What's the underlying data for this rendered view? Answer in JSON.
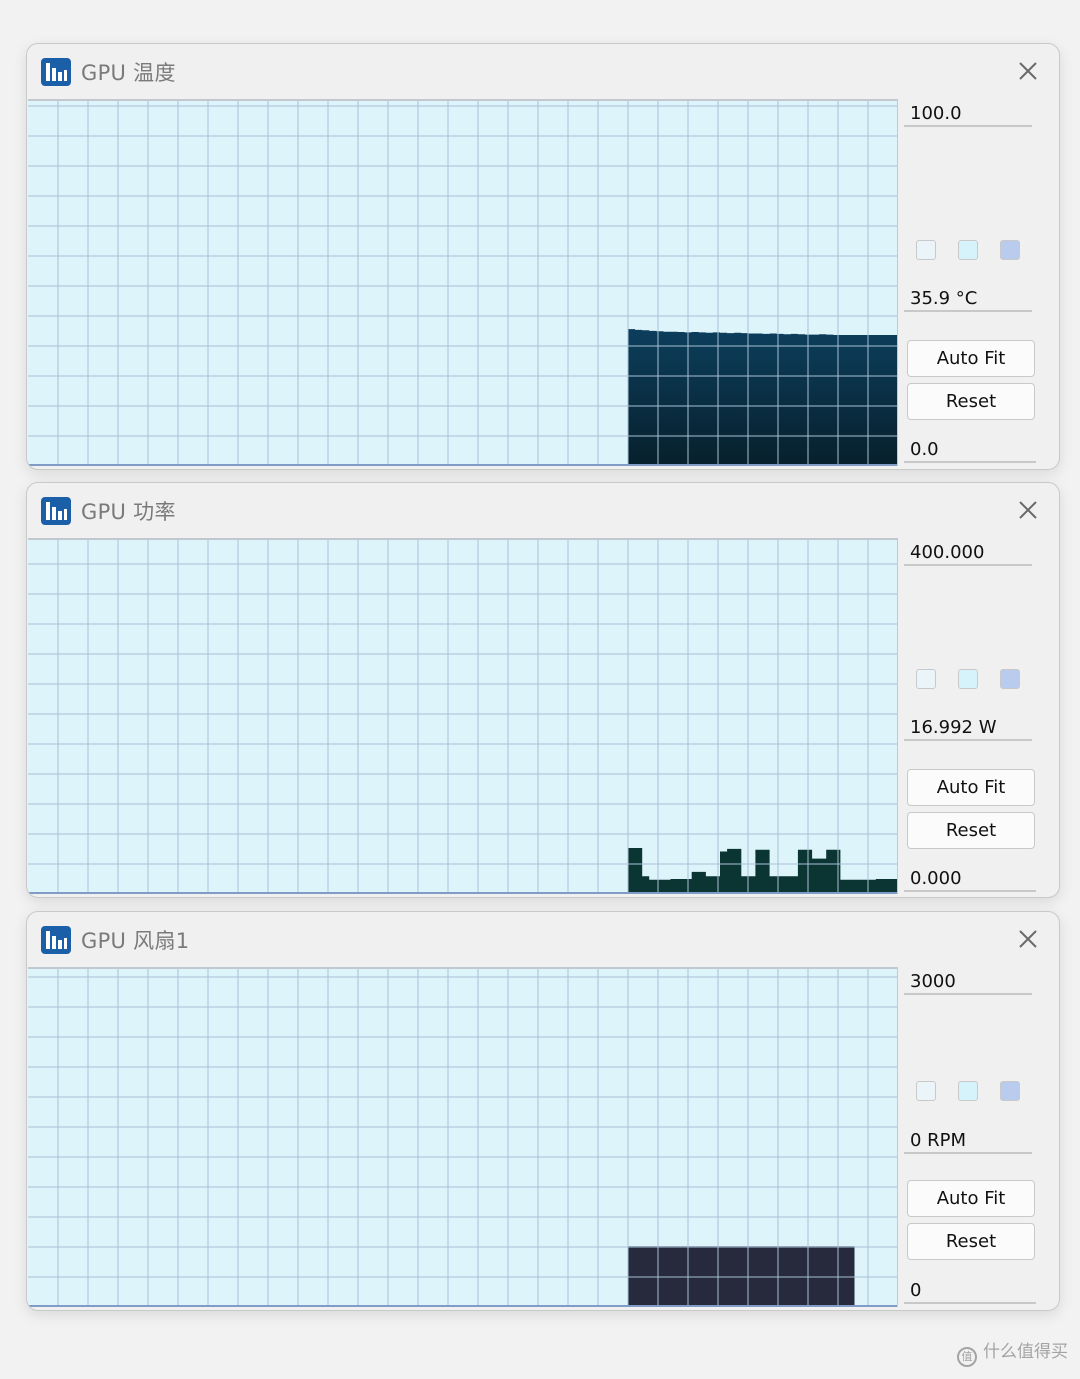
{
  "windows": [
    {
      "title": "GPU 温度",
      "max_value": "100.0",
      "current_value": "35.9 °C",
      "min_value": "0.0",
      "auto_fit_label": "Auto Fit",
      "reset_label": "Reset",
      "fill_color": "#0c3e5c",
      "graph_style": "area-gradient",
      "samples": [
        37.5,
        37.3,
        37.2,
        37.0,
        36.9,
        36.8,
        36.8,
        36.7,
        36.6,
        36.7,
        36.6,
        36.5,
        36.6,
        36.5,
        36.4,
        36.5,
        36.4,
        36.3,
        36.3,
        36.2,
        36.3,
        36.2,
        36.1,
        36.2,
        36.1,
        36.0,
        36.0,
        36.1,
        36.0,
        35.9,
        35.9,
        35.9,
        35.9,
        35.9,
        35.9,
        35.9,
        35.9,
        35.9
      ],
      "swatches": [
        "#ebf5f9",
        "#d6f2fa",
        "#b9cced"
      ]
    },
    {
      "title": "GPU 功率",
      "max_value": "400.000",
      "current_value": "16.992 W",
      "min_value": "0.000",
      "auto_fit_label": "Auto Fit",
      "reset_label": "Reset",
      "fill_color": "#0b3532",
      "graph_style": "area-solid",
      "samples": [
        52,
        52,
        20,
        16,
        16,
        16,
        17,
        17,
        17,
        25,
        25,
        20,
        20,
        48,
        51,
        51,
        20,
        20,
        50,
        50,
        20,
        20,
        20,
        20,
        50,
        50,
        40,
        40,
        50,
        50,
        16,
        16,
        16,
        16,
        16,
        17,
        17,
        17
      ],
      "swatches": [
        "#ebf5f9",
        "#d6f2fa",
        "#b9cced"
      ]
    },
    {
      "title": "GPU 风扇1",
      "max_value": "3000",
      "current_value": "0 RPM",
      "min_value": "0",
      "auto_fit_label": "Auto Fit",
      "reset_label": "Reset",
      "fill_color": "#262a3c",
      "graph_style": "area-dark",
      "samples": [
        540,
        540,
        540,
        540,
        540,
        540,
        540,
        540,
        540,
        540,
        540,
        540,
        540,
        540,
        540,
        540,
        540,
        540,
        540,
        540,
        540,
        540,
        540,
        540,
        540,
        540,
        540,
        540,
        540,
        540,
        540,
        540,
        0,
        0,
        0,
        0,
        0,
        0
      ],
      "swatches": [
        "#ebf5f9",
        "#d6f2fa",
        "#b9cced"
      ]
    }
  ],
  "watermark": "什么值得买"
}
